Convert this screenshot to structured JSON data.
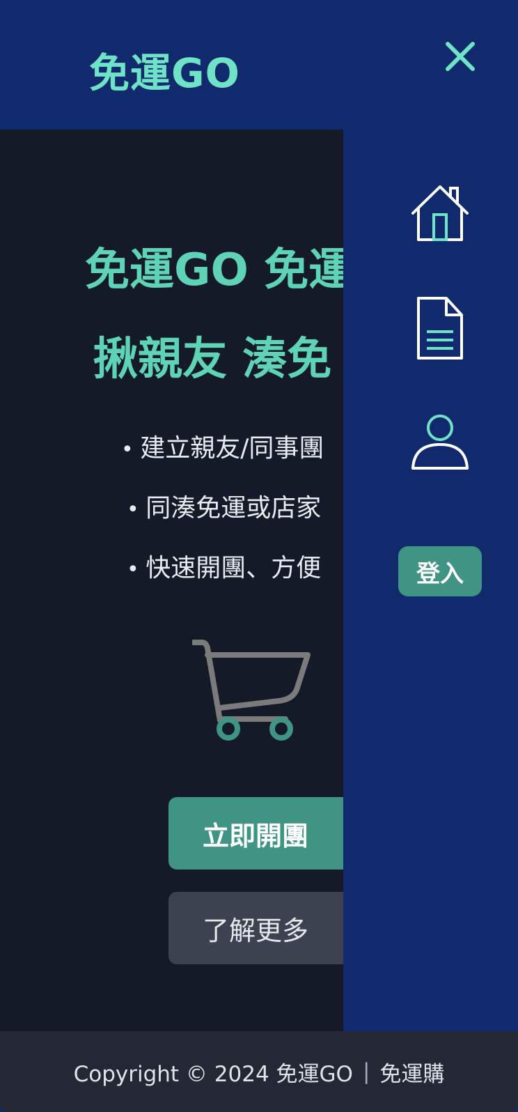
{
  "header": {
    "logo": "免運GO",
    "close_icon": "close-icon",
    "accent": "#6fe3c8"
  },
  "hero": {
    "title_line1": "免運GO 免運",
    "title_line2": "揪親友 湊免",
    "bullets": [
      "建立親友/同事團",
      "同湊免運或店家",
      "快速開團、方便"
    ],
    "cart_icon": "shopping-cart-icon",
    "primary_button": "立即開團",
    "secondary_button": "了解更多"
  },
  "sidebar": {
    "icons": [
      "home-icon",
      "document-icon",
      "user-icon"
    ],
    "login_button": "登入"
  },
  "footer": {
    "copyright": "Copyright © 2024 免運GO",
    "separator": "|",
    "brand": "免運購"
  },
  "colors": {
    "navy": "#102a6d",
    "dark": "#141a27",
    "teal": "#3f9483",
    "mint": "#5fd3b5"
  }
}
